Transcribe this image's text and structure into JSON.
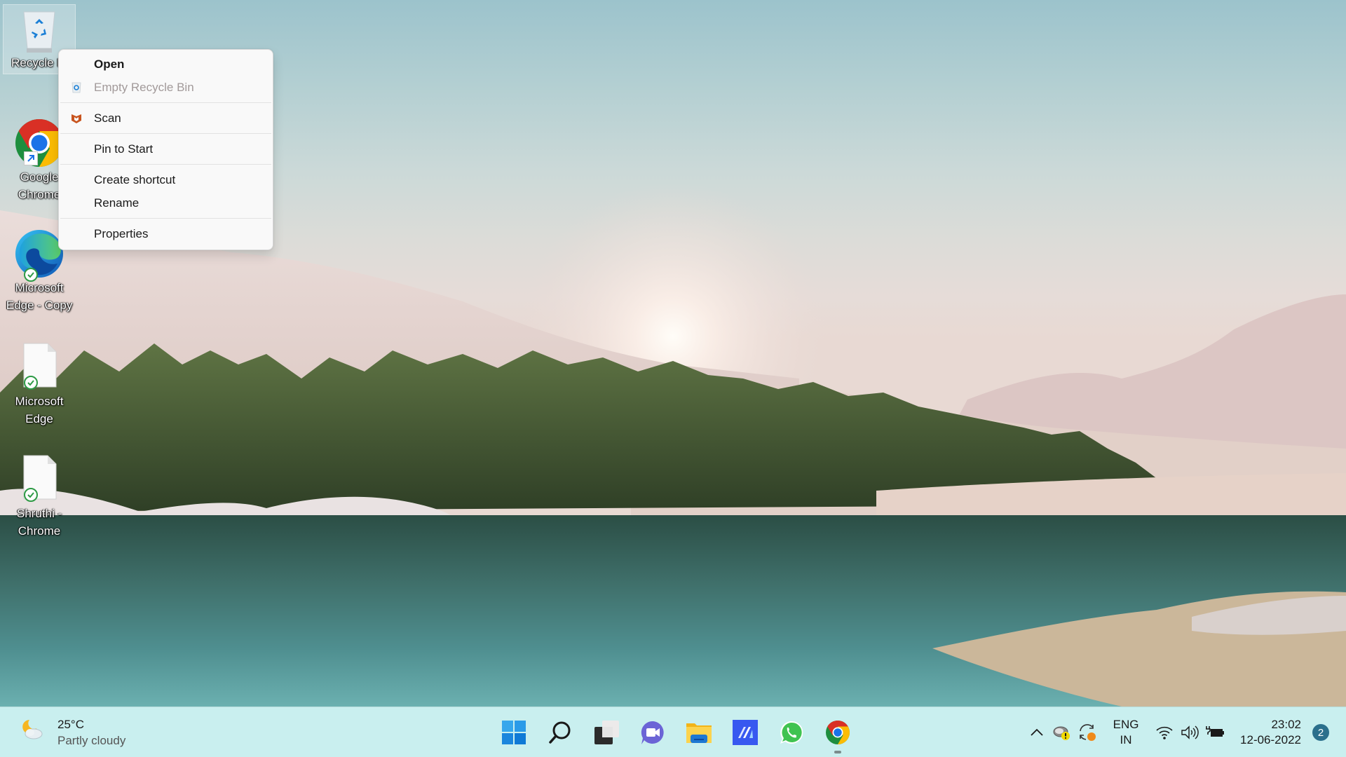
{
  "desktop": {
    "icons": [
      {
        "label_line1": "Recycle Bin",
        "label_line2": "",
        "icon": "recycle-bin-icon",
        "selected": true
      },
      {
        "label_line1": "Google",
        "label_line2": "Chrome",
        "icon": "chrome-icon",
        "overlay": "shortcut-arrow"
      },
      {
        "label_line1": "Microsoft",
        "label_line2": "Edge - Copy",
        "icon": "edge-icon",
        "overlay": "sync-check"
      },
      {
        "label_line1": "Microsoft",
        "label_line2": "Edge",
        "icon": "file-icon",
        "overlay": "sync-check"
      },
      {
        "label_line1": "Shruthi -",
        "label_line2": "Chrome",
        "icon": "file-icon",
        "overlay": "sync-check"
      }
    ]
  },
  "context_menu": {
    "items": [
      {
        "label": "Open",
        "bold": true
      },
      {
        "label": "Empty Recycle Bin",
        "disabled": true,
        "icon": "recycle-bin-icon"
      },
      {
        "label": "Scan",
        "icon": "mcafee-icon"
      },
      {
        "label": "Pin to Start"
      },
      {
        "label": "Create shortcut"
      },
      {
        "label": "Rename"
      },
      {
        "label": "Properties"
      }
    ]
  },
  "taskbar": {
    "weather": {
      "temperature": "25°C",
      "condition": "Partly cloudy",
      "icon": "moon-cloud-icon"
    },
    "apps": [
      {
        "name": "Start",
        "icon": "windows-start-icon"
      },
      {
        "name": "Search",
        "icon": "search-icon"
      },
      {
        "name": "Task View",
        "icon": "task-view-icon"
      },
      {
        "name": "Teams Chat",
        "icon": "teams-chat-icon"
      },
      {
        "name": "File Explorer",
        "icon": "file-explorer-icon"
      },
      {
        "name": "App",
        "icon": "app-blue-icon"
      },
      {
        "name": "WhatsApp",
        "icon": "whatsapp-icon"
      },
      {
        "name": "Google Chrome",
        "icon": "chrome-icon",
        "running": true
      }
    ],
    "tray": {
      "language_line1": "ENG",
      "language_line2": "IN",
      "time": "23:02",
      "date": "12-06-2022",
      "notification_count": "2"
    }
  }
}
